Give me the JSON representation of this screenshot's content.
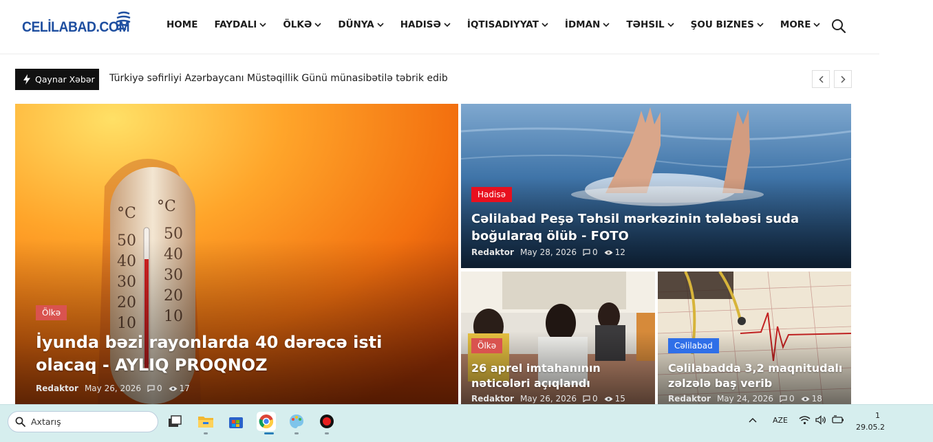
{
  "site": {
    "logo_text": "CELİLABAD.COM",
    "nav": [
      {
        "label": "HOME",
        "dropdown": false
      },
      {
        "label": "FAYDALI",
        "dropdown": true
      },
      {
        "label": "ÖLKƏ",
        "dropdown": true
      },
      {
        "label": "DÜNYA",
        "dropdown": true
      },
      {
        "label": "HADISƏ",
        "dropdown": true
      },
      {
        "label": "İQTISADIYYAT",
        "dropdown": true
      },
      {
        "label": "İDMAN",
        "dropdown": true
      },
      {
        "label": "TƏHSIL",
        "dropdown": true
      },
      {
        "label": "ŞOU BIZNES",
        "dropdown": true
      },
      {
        "label": "MORE",
        "dropdown": true
      }
    ]
  },
  "breaking": {
    "label": "Qaynar Xəbər",
    "headline": "Türkiyə səfirliyi Azərbaycanı Müstəqillik Günü münasibətilə təbrik edib"
  },
  "articles": [
    {
      "category": "Ölkə",
      "category_color": "#d9534f",
      "title": "İyunda bəzi rayonlarda 40 dərəcə isti olacaq - AYLIQ PROQNOZ",
      "author": "Redaktor",
      "date": "May 26, 2026",
      "comments": "0",
      "views": "17"
    },
    {
      "category": "Hadisə",
      "category_color": "#e8101e",
      "title": "Cəlilabad Peşə Təhsil mərkəzinin tələbəsi suda boğularaq ölüb - FOTO",
      "author": "Redaktor",
      "date": "May 28, 2026",
      "comments": "0",
      "views": "12"
    },
    {
      "category": "Ölkə",
      "category_color": "#d9534f",
      "title": "26 aprel imtahanının nəticələri açıqlandı",
      "author": "Redaktor",
      "date": "May 26, 2026",
      "comments": "0",
      "views": "15"
    },
    {
      "category": "Cəlilabad",
      "category_color": "#2f6fe8",
      "title": "Cəlilabadda 3,2 maqnitudalı zəlzələ baş verib",
      "author": "Redaktor",
      "date": "May 24, 2026",
      "comments": "0",
      "views": "18"
    }
  ],
  "taskbar": {
    "search_placeholder": "Axtarış",
    "apps": [
      "task-view-icon",
      "file-explorer-icon",
      "microsoft-store-icon",
      "chrome-icon",
      "paint-icon",
      "record-icon"
    ],
    "language": "AZE",
    "time": "1",
    "date": "29.05.2"
  }
}
